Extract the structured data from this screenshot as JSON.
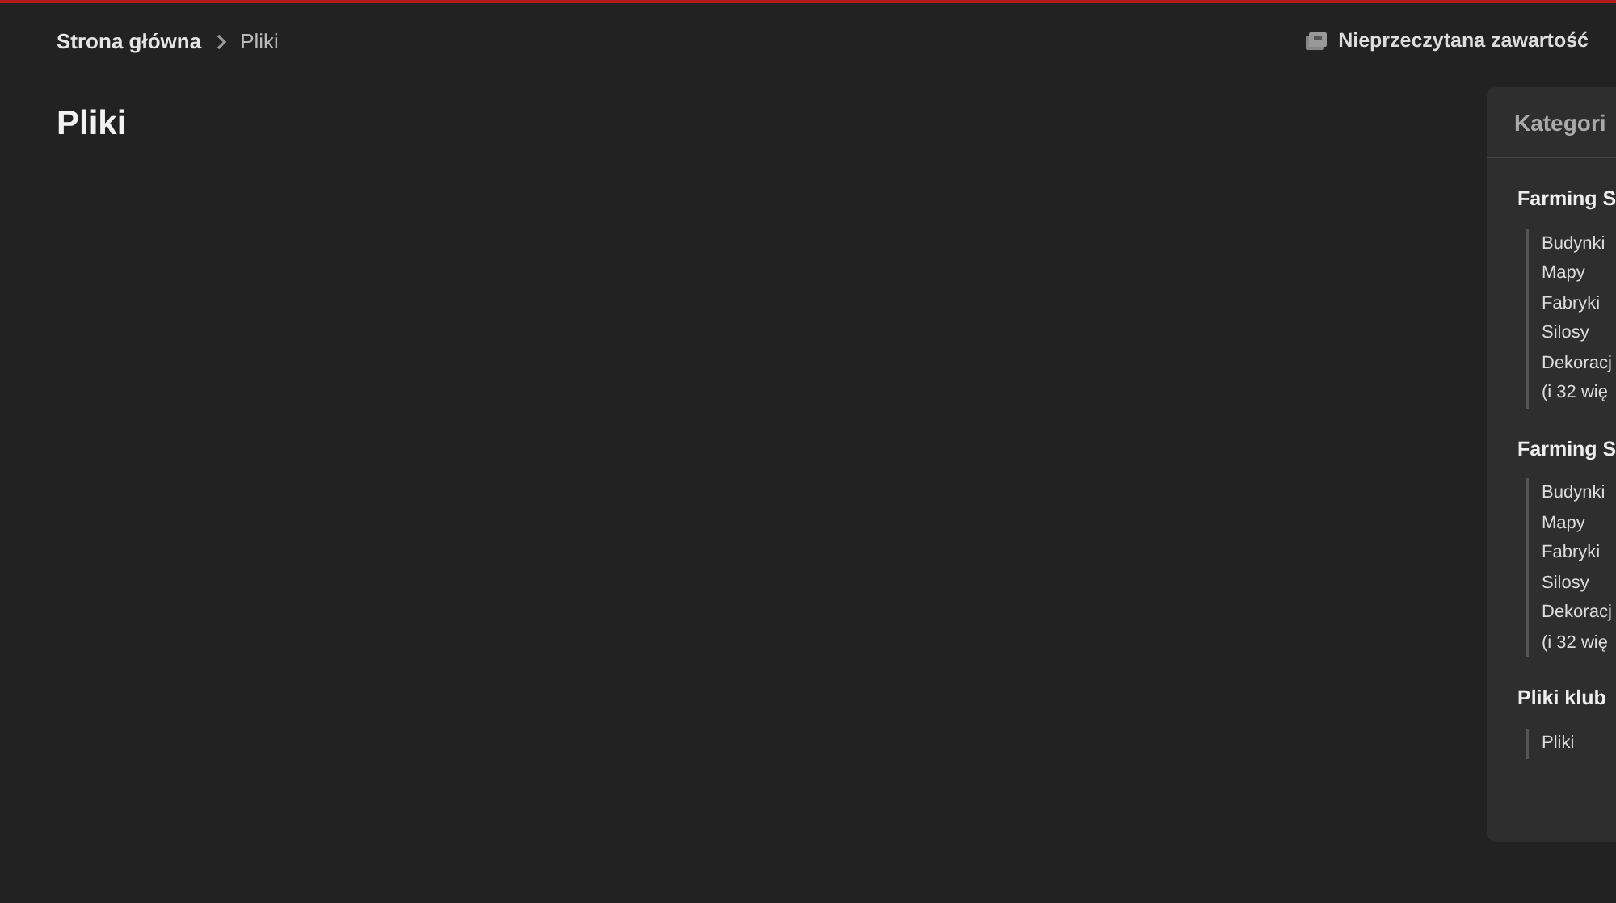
{
  "breadcrumb": [
    {
      "label": "Strona główna",
      "current": false
    },
    {
      "label": "Pliki",
      "current": true
    }
  ],
  "unread_link": {
    "label": "Nieprzeczytana zawartość"
  },
  "page_title": "Pliki",
  "sidebar": {
    "title": "Kategori",
    "groups": [
      {
        "title": "Farming S",
        "items": [
          "Budynki",
          "Mapy",
          "Fabryki",
          "Silosy",
          "Dekoracj",
          "(i 32 wię"
        ]
      },
      {
        "title": "Farming S",
        "items": [
          "Budynki",
          "Mapy",
          "Fabryki",
          "Silosy",
          "Dekoracj",
          "(i 32 wię"
        ]
      },
      {
        "title": "Pliki klub",
        "items": [
          "Pliki"
        ]
      }
    ]
  }
}
